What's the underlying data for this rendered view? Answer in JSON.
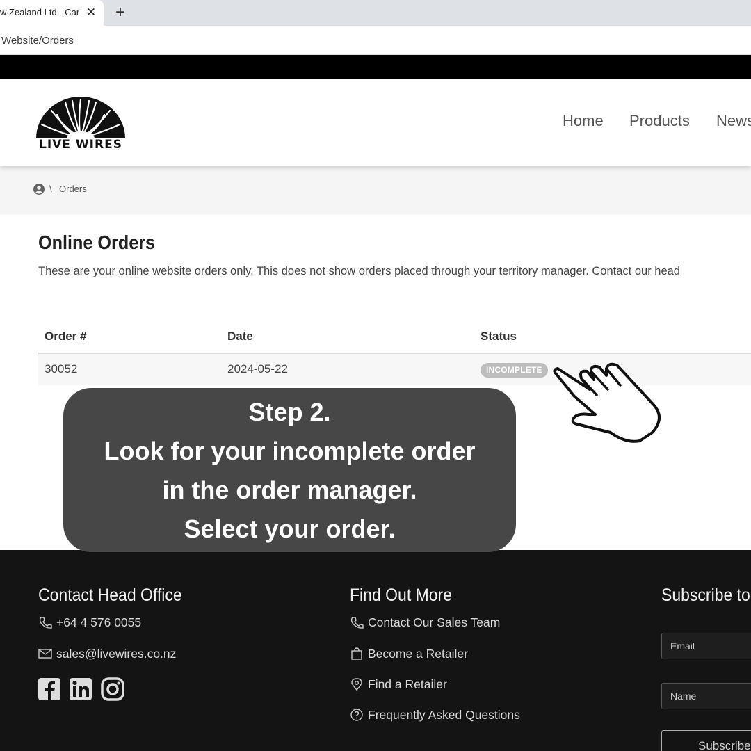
{
  "browser": {
    "tab_title": "w Zealand Ltd - Car",
    "tab_close": "✕",
    "new_tab": "+",
    "url": "Website/Orders"
  },
  "header": {
    "logo_text": "LIVE WIRES",
    "nav": [
      "Home",
      "Products",
      "News"
    ]
  },
  "breadcrumb": {
    "separator": "\\",
    "current": "Orders"
  },
  "main": {
    "title": "Online Orders",
    "description": "These are your online website orders only. This does not show orders placed through your territory manager. Contact our head",
    "table": {
      "columns": [
        "Order #",
        "Date",
        "Status"
      ],
      "rows": [
        {
          "order": "30052",
          "date": "2024-05-22",
          "status": "INCOMPLETE"
        }
      ]
    }
  },
  "callout": {
    "lines": [
      "Step 2.",
      "Look for your incomplete order",
      "in the order manager.",
      "Select your order."
    ]
  },
  "footer": {
    "contact_heading": "Contact Head Office",
    "phone": "+64 4 576 0055",
    "email": "sales@livewires.co.nz",
    "more_heading": "Find Out More",
    "links": [
      "Contact Our Sales Team",
      "Become a Retailer",
      "Find a Retailer",
      "Frequently Asked Questions"
    ],
    "subscribe_heading": "Subscribe to",
    "email_placeholder": "Email",
    "name_placeholder": "Name",
    "subscribe_button": "Subscribe"
  },
  "colors": {
    "footer_bg": "#141414",
    "callout_bg": "#474747",
    "badge_bg": "#bdbdbd"
  }
}
